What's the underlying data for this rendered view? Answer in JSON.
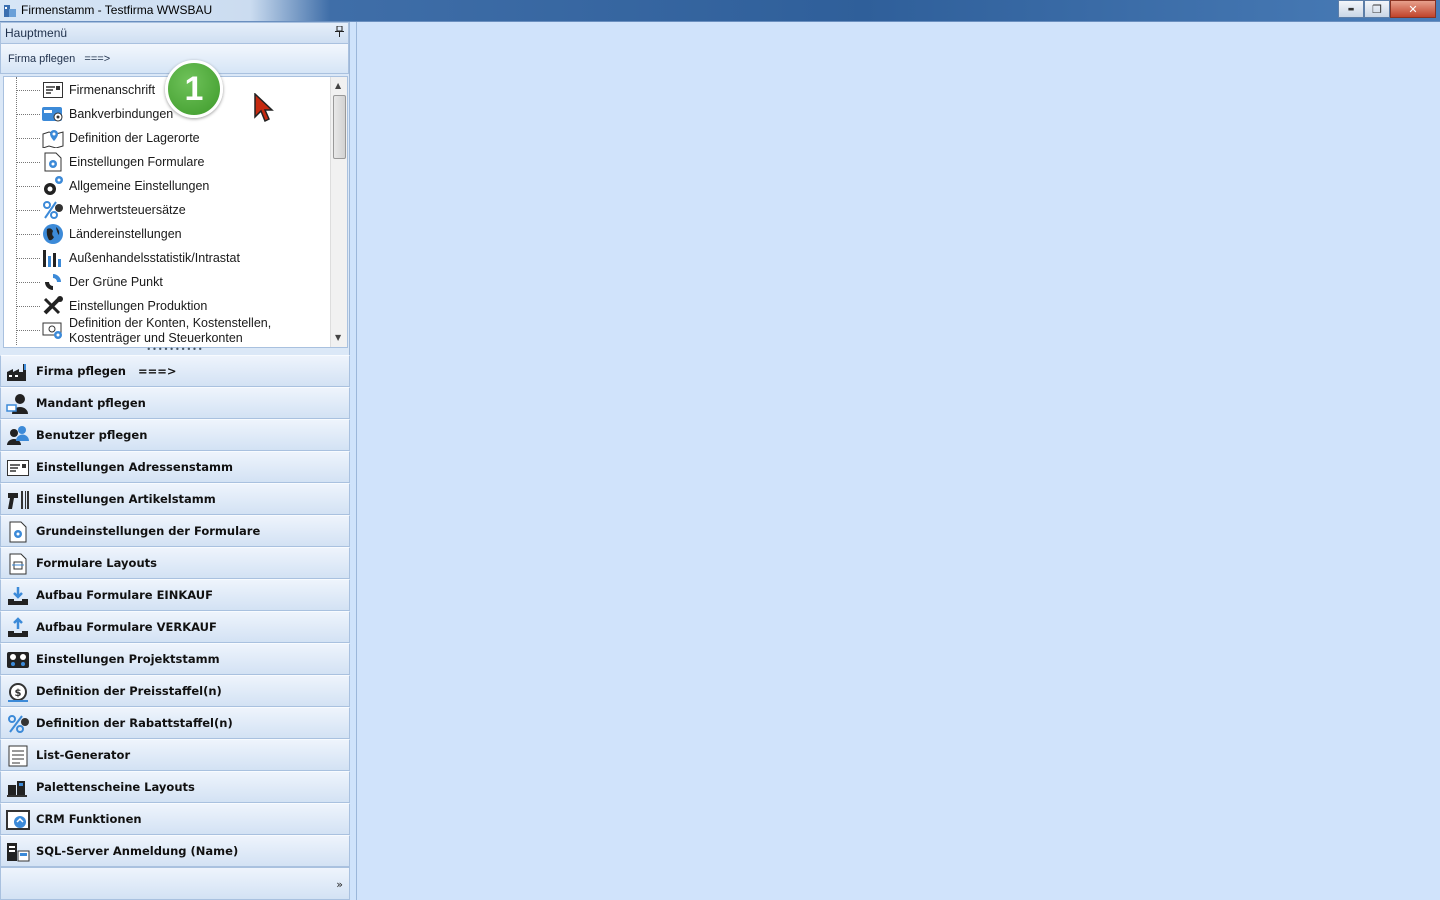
{
  "window": {
    "title": "Firmenstamm - Testfirma WWSBAU",
    "minimize_label": "▬",
    "restore_label": "❐",
    "close_label": "✕"
  },
  "panel": {
    "header": "Hauptmenü",
    "pin_label": "🖈",
    "group_header": "Firma pflegen   ===>"
  },
  "tree": {
    "items": [
      {
        "label": "Firmenanschrift",
        "icon": "address-card-icon"
      },
      {
        "label": "Bankverbindungen",
        "icon": "bank-card-icon"
      },
      {
        "label": "Definition der Lagerorte",
        "icon": "map-pin-icon"
      },
      {
        "label": "Einstellungen Formulare",
        "icon": "form-gear-icon"
      },
      {
        "label": "Allgemeine Einstellungen",
        "icon": "gears-icon"
      },
      {
        "label": "Mehrwertsteuersätze",
        "icon": "percent-icon"
      },
      {
        "label": "Ländereinstellungen",
        "icon": "globe-icon"
      },
      {
        "label": "Außenhandelsstatistik/Intrastat",
        "icon": "bar-chart-icon"
      },
      {
        "label": "Der Grüne Punkt",
        "icon": "recycle-icon"
      },
      {
        "label": "Einstellungen Produktion",
        "icon": "tools-icon"
      },
      {
        "label": "Definition der Konten, Kostenstellen, Kostenträger und Steuerkonten",
        "icon": "money-gear-icon"
      }
    ]
  },
  "nav": {
    "items": [
      {
        "label": "Firma pflegen   ===>",
        "icon": "factory-icon"
      },
      {
        "label": "Mandant pflegen",
        "icon": "user-monitor-icon"
      },
      {
        "label": "Benutzer pflegen",
        "icon": "users-icon"
      },
      {
        "label": "Einstellungen Adressenstamm",
        "icon": "address-card-icon"
      },
      {
        "label": "Einstellungen Artikelstamm",
        "icon": "barcode-scanner-icon"
      },
      {
        "label": "Grundeinstellungen der Formulare",
        "icon": "form-gear-icon"
      },
      {
        "label": "Formulare Layouts",
        "icon": "form-layout-icon"
      },
      {
        "label": "Aufbau Formulare EINKAUF",
        "icon": "inbox-download-icon"
      },
      {
        "label": "Aufbau Formulare VERKAUF",
        "icon": "inbox-upload-icon"
      },
      {
        "label": "Einstellungen Projektstamm",
        "icon": "project-icon"
      },
      {
        "label": "Definition der Preisstaffel(n)",
        "icon": "price-tag-icon"
      },
      {
        "label": "Definition der Rabattstaffel(n)",
        "icon": "discount-percent-icon"
      },
      {
        "label": "List-Generator",
        "icon": "list-document-icon"
      },
      {
        "label": "Palettenscheine Layouts",
        "icon": "pallet-icon"
      },
      {
        "label": "CRM Funktionen",
        "icon": "crm-icon"
      },
      {
        "label": "SQL-Server Anmeldung (Name)",
        "icon": "server-icon"
      }
    ],
    "more_label": "»"
  },
  "annotation": {
    "badge_number": "1"
  },
  "colors": {
    "main_background": "#d0e3fb",
    "badge_green": "#4aa535"
  }
}
